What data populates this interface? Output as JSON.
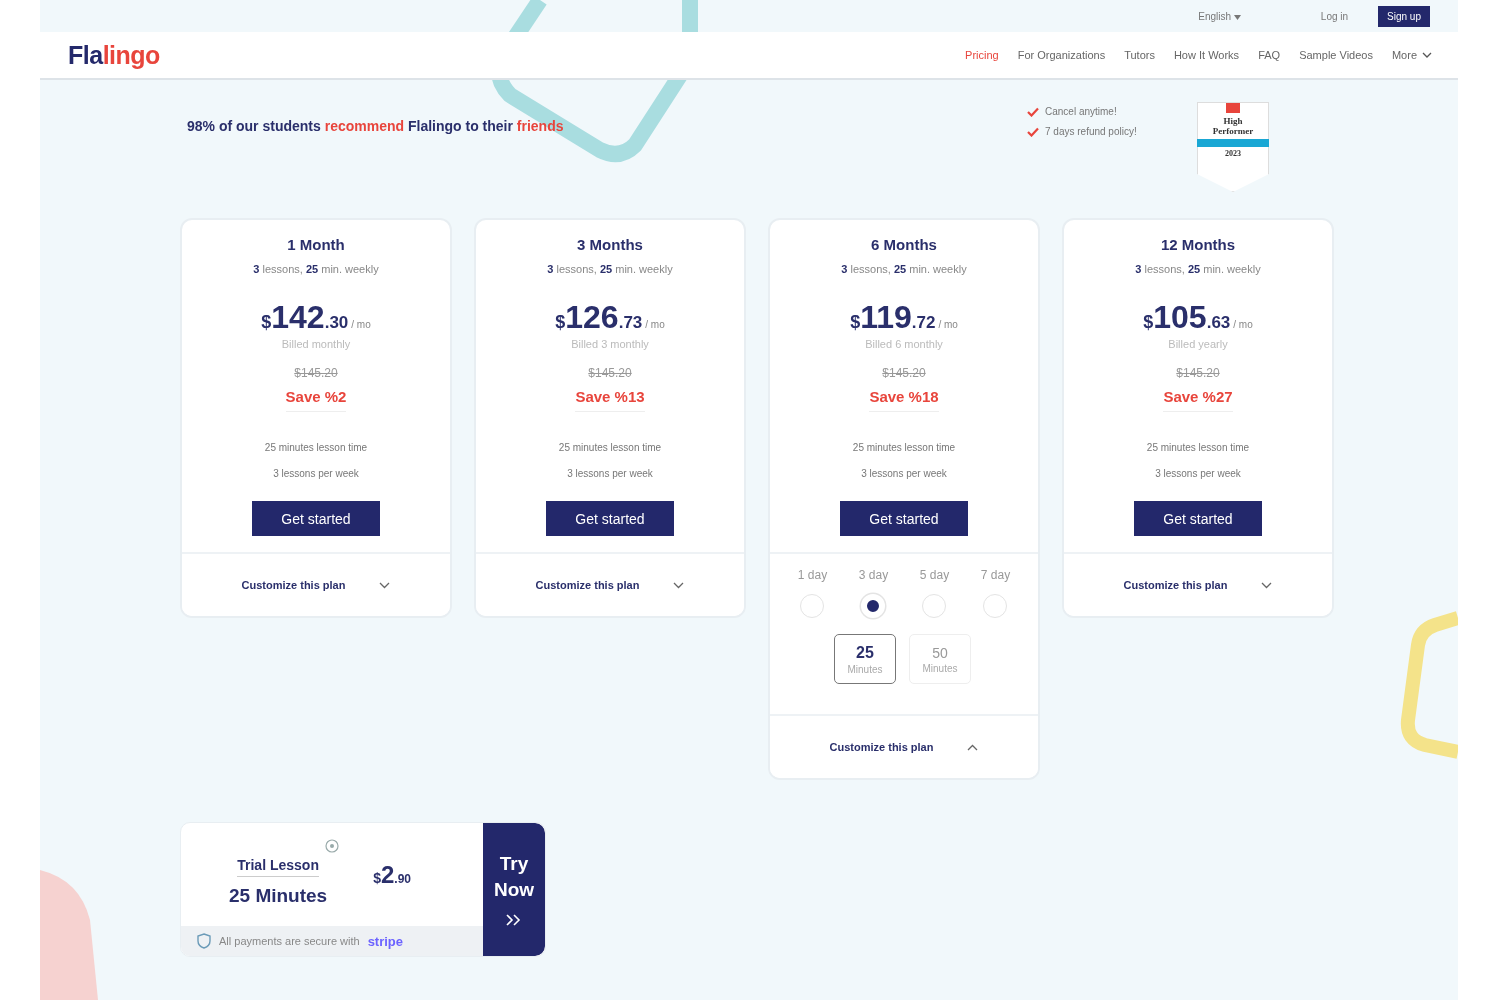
{
  "top_bar": {
    "language": "English",
    "login": "Log in",
    "signup": "Sign up"
  },
  "nav": {
    "logo": [
      {
        "text": "Fla",
        "accent": false
      },
      {
        "text": "lingo",
        "accent": true
      }
    ],
    "items": [
      {
        "label": "Pricing",
        "selected": true
      },
      {
        "label": "For Organizations",
        "selected": false
      },
      {
        "label": "Tutors",
        "selected": false
      },
      {
        "label": "How It Works",
        "selected": false
      },
      {
        "label": "FAQ",
        "selected": false
      },
      {
        "label": "Sample Videos",
        "selected": false
      },
      {
        "label": "More",
        "selected": false,
        "kind": "dropdown"
      }
    ]
  },
  "headline": [
    {
      "text": "98% of our students ",
      "accent": false
    },
    {
      "text": "recommend",
      "accent": true
    },
    {
      "text": " Flalingo to their ",
      "accent": false
    },
    {
      "text": "friends",
      "accent": true
    }
  ],
  "guarantees": [
    "Cancel anytime!",
    "7 days refund policy!"
  ],
  "award_badge": {
    "title": "High Performer",
    "year": "2023"
  },
  "plans": [
    {
      "title": "**1** Month",
      "subtitle": "**3** lessons, **25** min. weekly",
      "currency": "$",
      "whole": "142",
      "cents": ".30",
      "per": "/ mo",
      "billing": "Billed monthly",
      "old_price": "$145.20",
      "save": "Save %2",
      "features": [
        "25 minutes lesson time",
        "3 lessons per week"
      ],
      "button": "Get started",
      "customize": "Customize this plan",
      "expanded": false
    },
    {
      "title": "**3** Months",
      "subtitle": "**3** lessons, **25** min. weekly",
      "currency": "$",
      "whole": "126",
      "cents": ".73",
      "per": "/ mo",
      "billing": "Billed 3 monthly",
      "old_price": "$145.20",
      "save": "Save %13",
      "features": [
        "25 minutes lesson time",
        "3 lessons per week"
      ],
      "button": "Get started",
      "customize": "Customize this plan",
      "expanded": false
    },
    {
      "title": "**6** Months",
      "subtitle": "**3** lessons, **25** min. weekly",
      "currency": "$",
      "whole": "119",
      "cents": ".72",
      "per": "/ mo",
      "billing": "Billed 6 monthly",
      "old_price": "$145.20",
      "save": "Save %18",
      "features": [
        "25 minutes lesson time",
        "3 lessons per week"
      ],
      "button": "Get started",
      "customize": "Customize this plan",
      "expanded": true,
      "days": [
        {
          "label": "1 day",
          "selected": false
        },
        {
          "label": "3 day",
          "selected": true
        },
        {
          "label": "5 day",
          "selected": false
        },
        {
          "label": "7 day",
          "selected": false
        }
      ],
      "durations": [
        {
          "value": "25",
          "unit": "Minutes",
          "selected": true
        },
        {
          "value": "50",
          "unit": "Minutes",
          "selected": false
        }
      ]
    },
    {
      "title": "**12** Months",
      "subtitle": "**3** lessons, **25** min. weekly",
      "currency": "$",
      "whole": "105",
      "cents": ".63",
      "per": "/ mo",
      "billing": "Billed yearly",
      "old_price": "$145.20",
      "save": "Save %27",
      "features": [
        "25 minutes lesson time",
        "3 lessons per week"
      ],
      "button": "Get started",
      "customize": "Customize this plan",
      "expanded": false
    }
  ],
  "trial": {
    "title": "Trial Lesson",
    "duration": "25 Minutes",
    "currency": "$",
    "whole": "2",
    "cents": ".90",
    "secure_text": "All payments are secure with",
    "secure_brand": "stripe",
    "button_line1": "Try",
    "button_line2": "Now"
  }
}
